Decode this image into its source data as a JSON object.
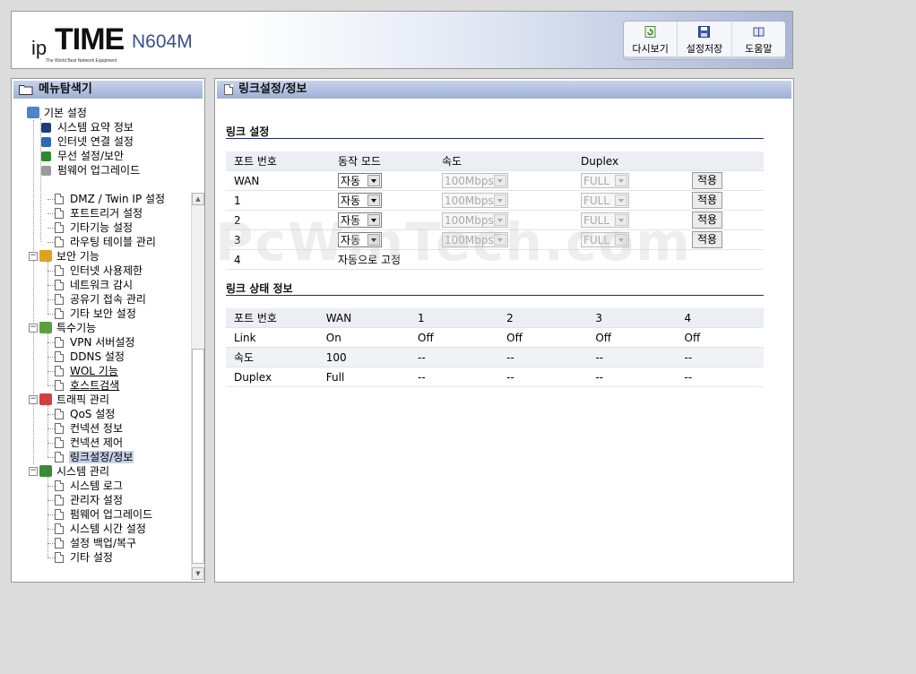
{
  "header": {
    "logo_ip": "ip",
    "logo_time": "TIME",
    "logo_model": "N604M",
    "logo_tagline": "The World Best Network Equipment",
    "buttons": [
      {
        "label": "다시보기",
        "icon": "refresh-icon"
      },
      {
        "label": "설정저장",
        "icon": "floppy-disk-icon"
      },
      {
        "label": "도움말",
        "icon": "book-icon"
      }
    ]
  },
  "sidebar": {
    "title": "메뉴탐색기",
    "tree": [
      {
        "label": "기본 설정",
        "type": "group"
      },
      {
        "label": "시스템 요약 정보",
        "type": "item"
      },
      {
        "label": "인터넷 연결 설정",
        "type": "item"
      },
      {
        "label": "무선 설정/보안",
        "type": "item"
      },
      {
        "label": "펌웨어 업그레이드",
        "type": "item"
      },
      {
        "label": "DMZ / Twin IP 설정",
        "type": "item"
      },
      {
        "label": "포트트리거 설정",
        "type": "item"
      },
      {
        "label": "기타기능 설정",
        "type": "item"
      },
      {
        "label": "라우팅 테이블 관리",
        "type": "item"
      },
      {
        "label": "보안 기능",
        "type": "group"
      },
      {
        "label": "인터넷 사용제한",
        "type": "item"
      },
      {
        "label": "네트워크 감시",
        "type": "item"
      },
      {
        "label": "공유기 접속 관리",
        "type": "item"
      },
      {
        "label": "기타 보안 설정",
        "type": "item"
      },
      {
        "label": "특수기능",
        "type": "group"
      },
      {
        "label": "VPN 서버설정",
        "type": "item"
      },
      {
        "label": "DDNS 설정",
        "type": "item"
      },
      {
        "label": "WOL 기능",
        "type": "item"
      },
      {
        "label": "호스트검색",
        "type": "item"
      },
      {
        "label": "트래픽 관리",
        "type": "group"
      },
      {
        "label": "QoS 설정",
        "type": "item"
      },
      {
        "label": "컨넥션 정보",
        "type": "item"
      },
      {
        "label": "컨넥션 제어",
        "type": "item"
      },
      {
        "label": "링크설정/정보",
        "type": "item",
        "selected": true
      },
      {
        "label": "시스템 관리",
        "type": "group"
      },
      {
        "label": "시스템 로그",
        "type": "item"
      },
      {
        "label": "관리자 설정",
        "type": "item"
      },
      {
        "label": "펌웨어 업그레이드",
        "type": "item"
      },
      {
        "label": "시스템 시간 설정",
        "type": "item"
      },
      {
        "label": "설정 백업/복구",
        "type": "item"
      },
      {
        "label": "기타 설정",
        "type": "item"
      }
    ]
  },
  "main": {
    "title": "링크설정/정보",
    "link_settings": {
      "title": "링크 설정",
      "headers": [
        "포트 번호",
        "동작 모드",
        "속도",
        "Duplex"
      ],
      "rows": [
        {
          "port": "WAN",
          "mode": "자동",
          "speed": "100Mbps",
          "duplex": "FULL",
          "apply": "적용"
        },
        {
          "port": "1",
          "mode": "자동",
          "speed": "100Mbps",
          "duplex": "FULL",
          "apply": "적용"
        },
        {
          "port": "2",
          "mode": "자동",
          "speed": "100Mbps",
          "duplex": "FULL",
          "apply": "적용"
        },
        {
          "port": "3",
          "mode": "자동",
          "speed": "100Mbps",
          "duplex": "FULL",
          "apply": "적용"
        }
      ],
      "fixed_row": {
        "port": "4",
        "text": "자동으로 고정"
      }
    },
    "link_status": {
      "title": "링크 상태 정보",
      "headers": [
        "포트 번호",
        "WAN",
        "1",
        "2",
        "3",
        "4"
      ],
      "rows": [
        {
          "label": "Link",
          "values": [
            "On",
            "Off",
            "Off",
            "Off",
            "Off"
          ]
        },
        {
          "label": "속도",
          "values": [
            "100",
            "--",
            "--",
            "--",
            "--"
          ]
        },
        {
          "label": "Duplex",
          "values": [
            "Full",
            "--",
            "--",
            "--",
            "--"
          ]
        }
      ]
    }
  },
  "watermark": "PcWinTech.com",
  "colors": {
    "accent": "#9fb0d6",
    "section_line": "#1e2a6a",
    "header_gradient_end": "#a9b7d6"
  }
}
